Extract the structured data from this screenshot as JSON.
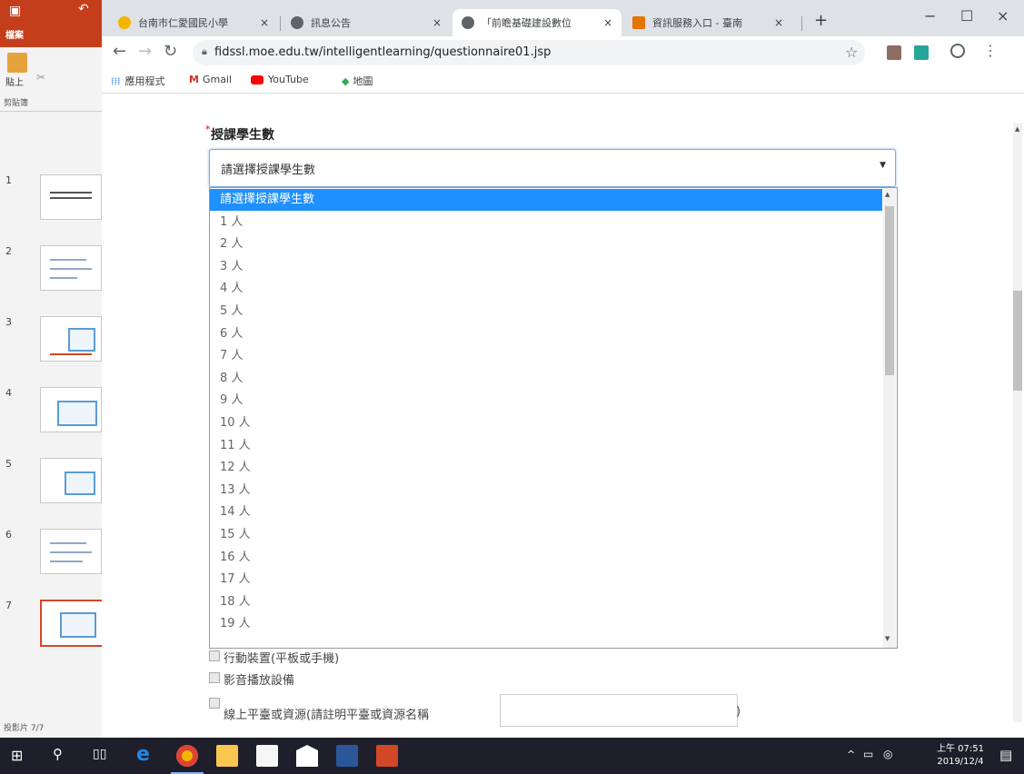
{
  "ppt": {
    "tab_file": "檔案",
    "paste_label": "貼上",
    "clipboard_label": "剪貼簿",
    "status": "投影片 7/7",
    "slide_numbers": [
      "1",
      "2",
      "3",
      "4",
      "5",
      "6",
      "7"
    ]
  },
  "browser": {
    "tabs": [
      {
        "title": "台南市仁愛國民小學",
        "close": "×"
      },
      {
        "title": "訊息公告",
        "close": "×"
      },
      {
        "title": "「前瞻基礎建設數位",
        "close": "×"
      },
      {
        "title": "資訊服務入口 - 臺南",
        "close": "×"
      }
    ],
    "new_tab": "+",
    "url": "fidssl.moe.edu.tw/intelligentlearning/questionnaire01.jsp",
    "bookmarks": [
      "應用程式",
      "Gmail",
      "YouTube",
      "地圖"
    ]
  },
  "form": {
    "required_mark": "*",
    "students_label": "授課學生數",
    "select_value": "請選擇授課學生數",
    "options": [
      "請選擇授課學生數",
      "1 人",
      "2 人",
      "3 人",
      "4 人",
      "5 人",
      "6 人",
      "7 人",
      "8 人",
      "9 人",
      "10 人",
      "11 人",
      "12 人",
      "13 人",
      "14 人",
      "15 人",
      "16 人",
      "17 人",
      "18 人",
      "19 人"
    ],
    "checkboxes": [
      "行動裝置(平板或手機)",
      "影音播放設備",
      "線上平臺或資源(請註明平臺或資源名稱"
    ],
    "close_paren": ")"
  },
  "taskbar": {
    "time": "上午 07:51",
    "date": "2019/12/4"
  },
  "colors": {
    "ppt_accent": "#c43e1c",
    "selected_option": "#1e90ff",
    "taskbar": "#1f1f2b"
  }
}
